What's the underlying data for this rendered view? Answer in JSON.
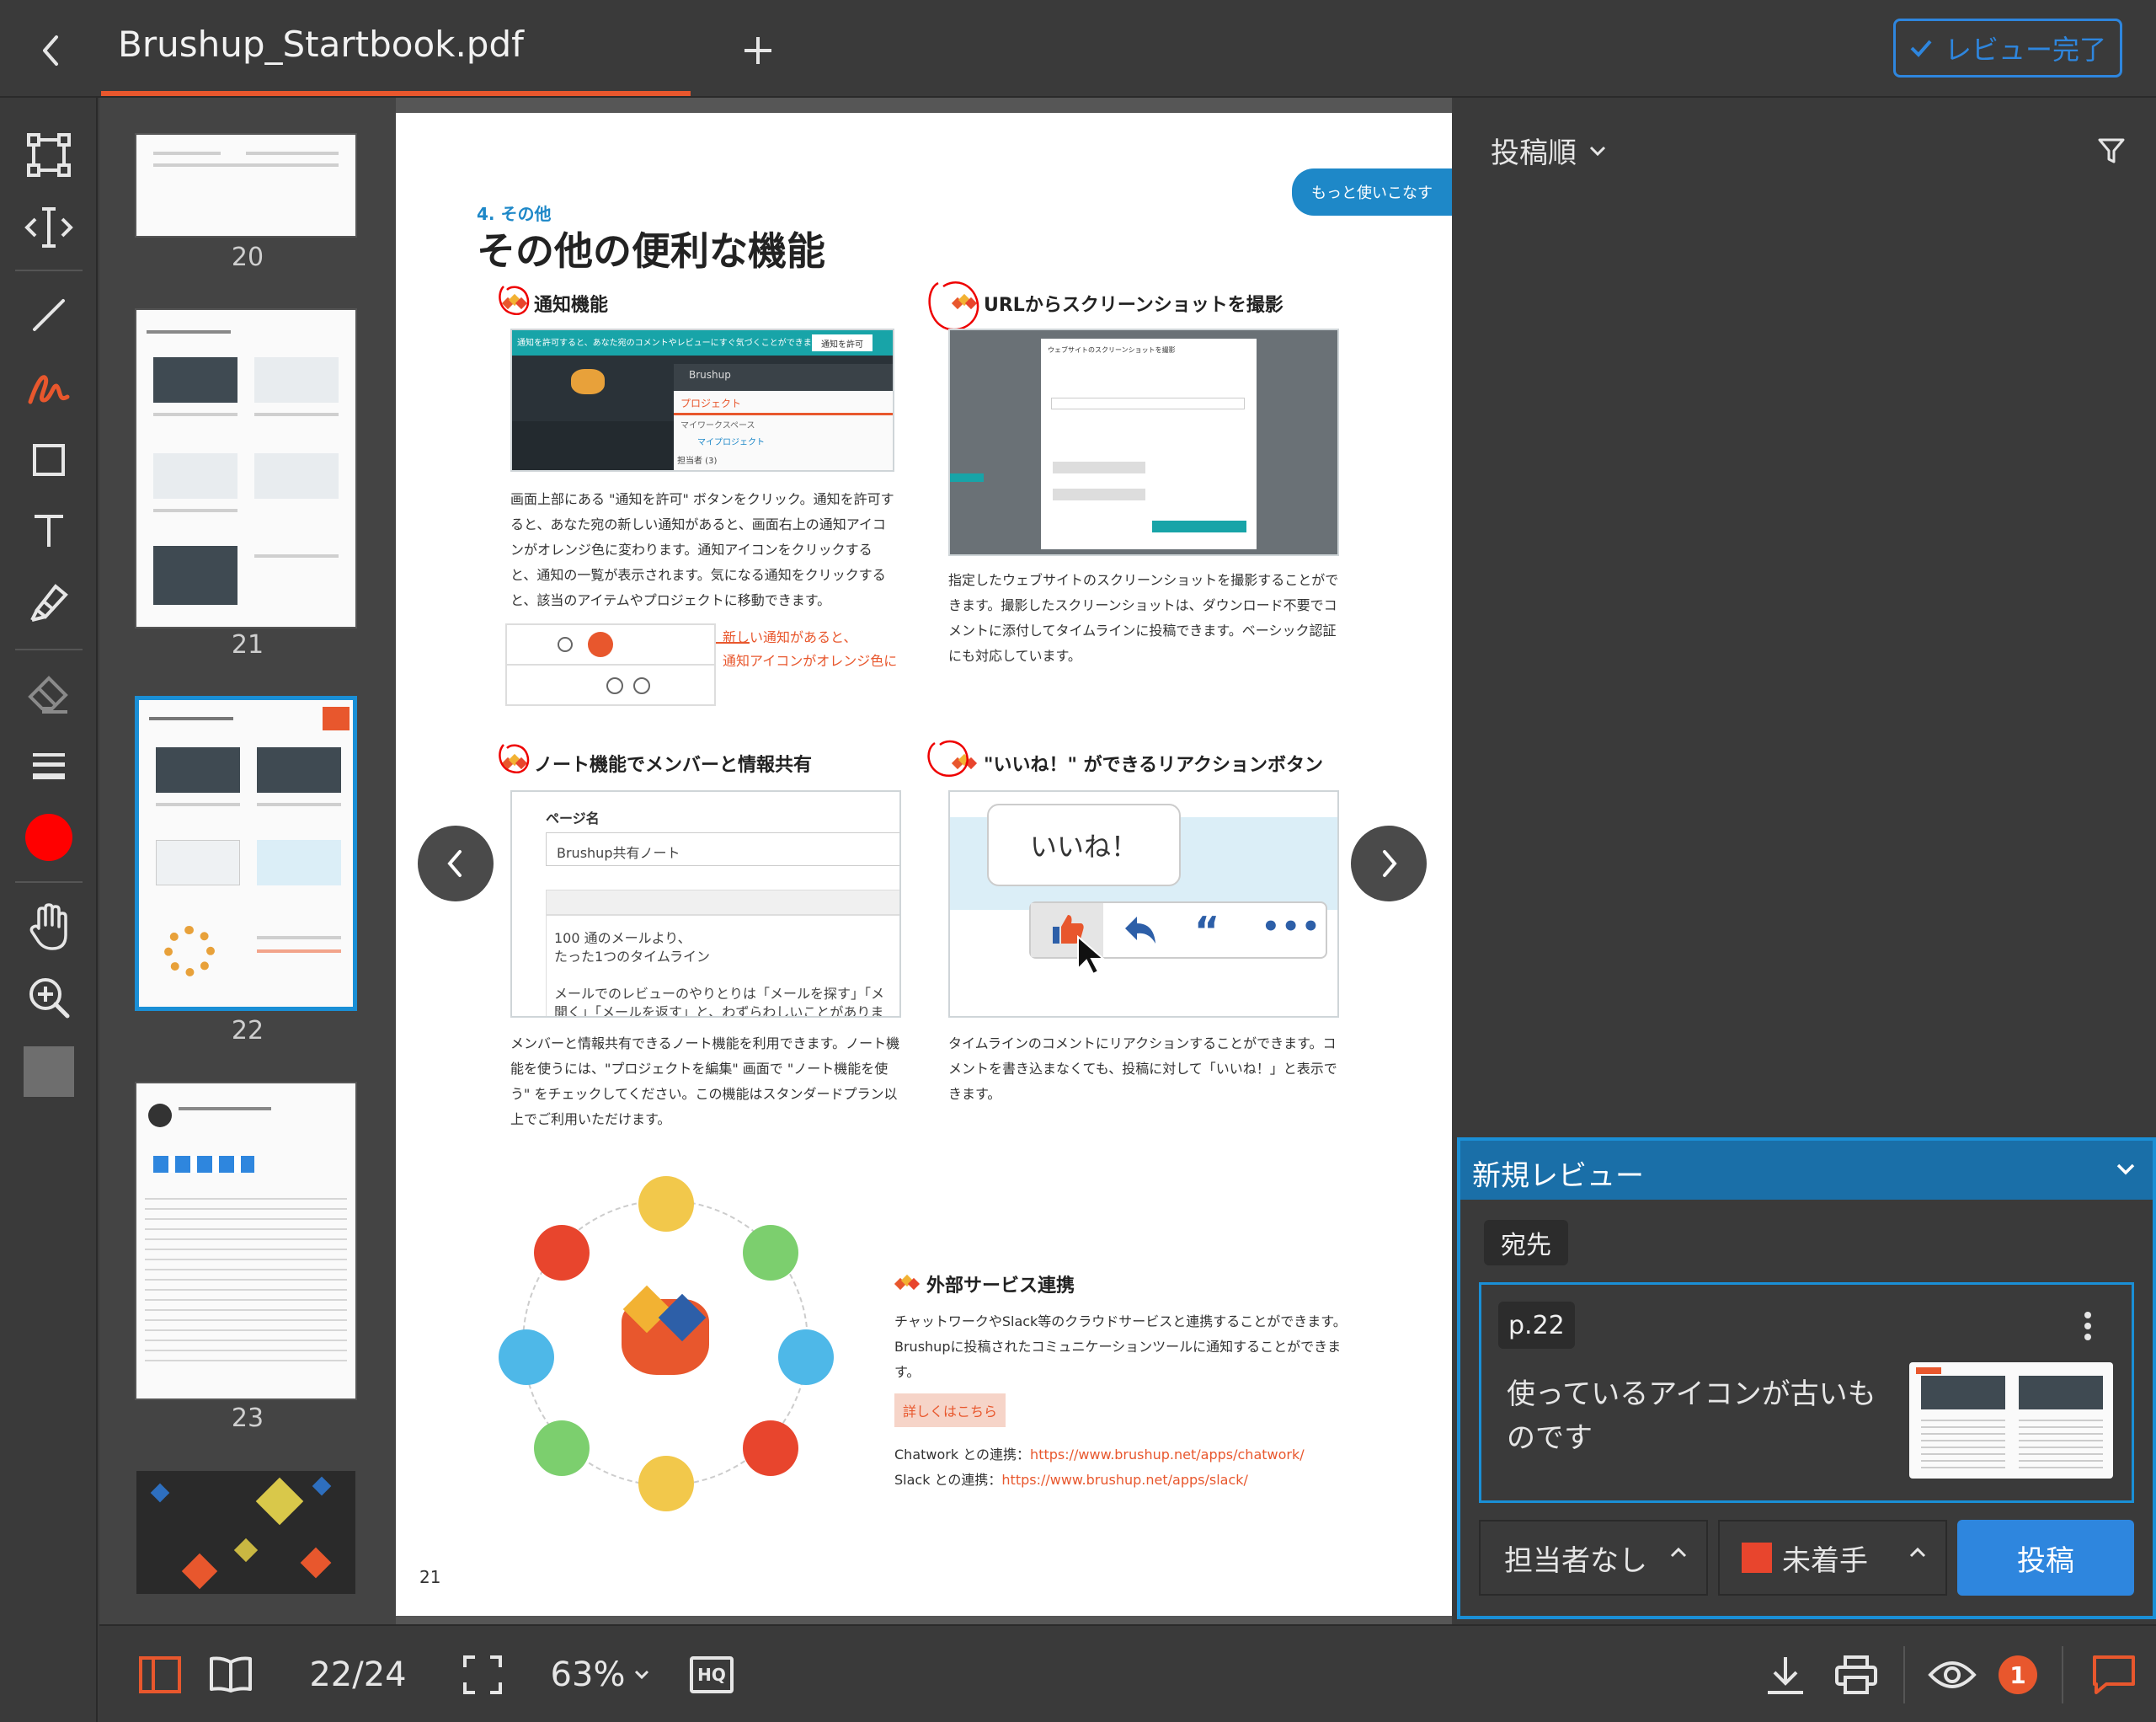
{
  "topbar": {
    "tab_title": "Brushup_Startbook.pdf",
    "review_done_label": "レビュー完了"
  },
  "toolbar": {
    "tools": [
      "select-rect",
      "text-select",
      "line",
      "freehand",
      "rectangle",
      "text",
      "highlighter",
      "eraser",
      "line-width",
      "color",
      "hand",
      "zoom-in",
      "fill"
    ],
    "active_tool": "freehand",
    "current_color": "#ff0000"
  },
  "thumbnails": [
    {
      "number": "20"
    },
    {
      "number": "21"
    },
    {
      "number": "22"
    },
    {
      "number": "23"
    }
  ],
  "page": {
    "section_label": "4. その他",
    "title": "その他の便利な機能",
    "badge": "もっと使いこなす",
    "f1": {
      "heading": "通知機能",
      "desc": "画面上部にある \"通知を許可\" ボタンをクリック。通知を許可すると、あなた宛の新しい通知があると、画面右上の通知アイコンがオレンジ色に変わります。通知アイコンをクリックすると、通知の一覧が表示されます。気になる通知をクリックすると、該当のアイテムやプロジェクトに移動できます。",
      "callout_1": "新しい通知があると、",
      "callout_2": "通知アイコンがオレンジ色に",
      "shot_banner": "通知を許可すると、あなた宛のコメントやレビューにすぐ気づくことができます。",
      "shot_allow_btn": "通知を許可",
      "shot_brand": "Brushup",
      "shot_project": "プロジェクト",
      "shot_workspace": "マイワークスペース",
      "shot_myproject": "マイプロジェクト",
      "shot_owner": "担当者 (3)"
    },
    "f2": {
      "heading": "URLからスクリーンショットを撮影",
      "desc": "指定したウェブサイトのスクリーンショットを撮影することができます。撮影したスクリーンショットは、ダウンロード不要でコメントに添付してタイムラインに投稿できます。ベーシック認証にも対応しています。",
      "dialog_title": "ウェブサイトのスクリーンショットを撮影"
    },
    "f3": {
      "heading": "ノート機能でメンバーと情報共有",
      "desc": "メンバーと情報共有できるノート機能を利用できます。ノート機能を使うには、\"プロジェクトを編集\" 画面で \"ノート機能を使う\" をチェックしてください。この機能はスタンダードプラン以上でご利用いただけます。",
      "note_page_label": "ページ名",
      "note_page_value": "Brushup共有ノート",
      "note_body_1": "100 通のメールより、",
      "note_body_2": "たった1つのタイムライン",
      "note_body_3": "メールでのレビューのやりとりは「メールを探す」「メ",
      "note_body_4": "開く」「メールを返す」と、わずらわしいことがありま"
    },
    "f4": {
      "heading": "\"いいね！\" ができるリアクションボタン",
      "desc": "タイムラインのコメントにリアクションすることができます。コメントを書き込まなくても、投稿に対して「いいね！」と表示できます。",
      "like_bubble": "いいね！"
    },
    "f5": {
      "heading": "外部サービス連携",
      "desc": "チャットワークやSlack等のクラウドサービスと連携することができます。Brushupに投稿されたコミュニケーションツールに通知することができます。",
      "details_btn": "詳しくはこちら",
      "chatwork_label": "Chatwork との連携：",
      "chatwork_url": "https://www.brushup.net/apps/chatwork/",
      "slack_label": "Slack との連携：",
      "slack_url": "https://www.brushup.net/apps/slack/"
    },
    "page_number": "21"
  },
  "right_panel": {
    "sort_label": "投稿順",
    "new_review": {
      "title": "新規レビュー",
      "dest_label": "宛先",
      "page_ref": "p.22",
      "comment": "使っているアイコンが古いものです",
      "assignee": "担当者なし",
      "status": "未着手",
      "status_color": "#e8452d",
      "post_label": "投稿"
    }
  },
  "bottombar": {
    "page_current": "22",
    "page_total": "24",
    "page_sep": "/",
    "zoom": "63%",
    "hq_label": "HQ",
    "notification_count": "1"
  }
}
